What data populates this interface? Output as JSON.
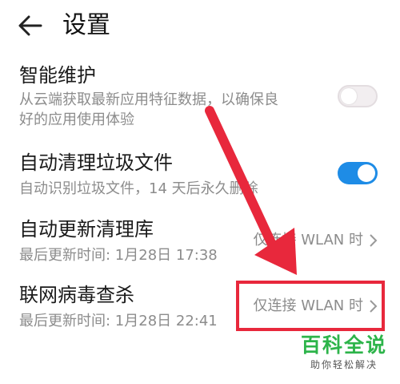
{
  "header": {
    "title": "设置",
    "back_icon": "arrow-left-icon"
  },
  "settings": [
    {
      "title": "智能维护",
      "desc_line1": "从云端获取最新应用特征数据，以确保良",
      "desc_line2": "好的应用使用体验",
      "toggle": "off"
    },
    {
      "title": "自动清理垃圾文件",
      "desc": "自动识别垃圾文件，14 天后永久删除",
      "toggle": "on",
      "toggle_color": "#1e8ce6"
    },
    {
      "title": "自动更新清理库",
      "desc": "最后更新时间: 1月28日 17:38",
      "value": "仅连接 WLAN 时"
    },
    {
      "title": "联网病毒查杀",
      "desc": "最后更新时间: 1月28日 22:41",
      "value": "仅连接 WLAN 时"
    }
  ],
  "annotation": {
    "color": "#e8283c"
  },
  "watermark": {
    "main": "百科全说",
    "sub": "助你轻松解决",
    "color": "#2db44a"
  }
}
